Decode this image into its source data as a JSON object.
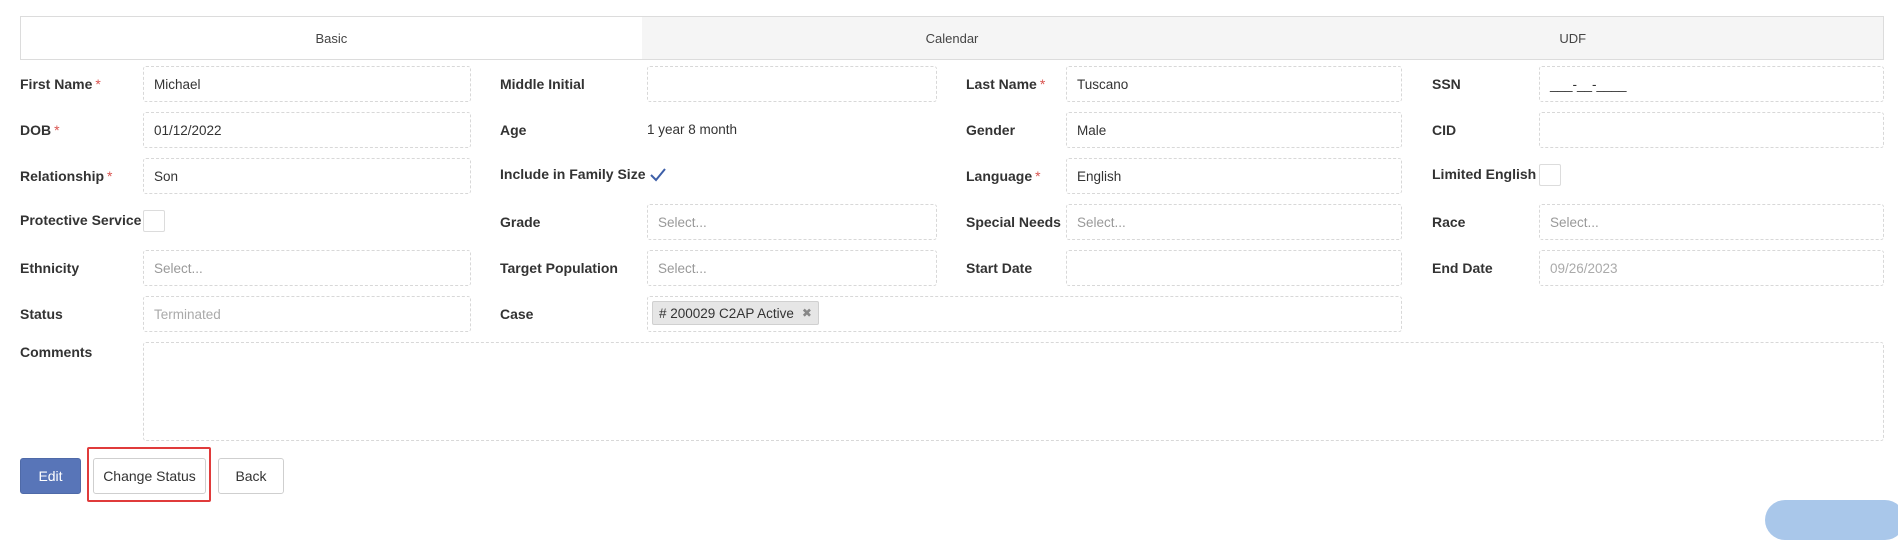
{
  "tabs": [
    "Basic",
    "Calendar",
    "UDF"
  ],
  "labels": {
    "first_name": "First Name",
    "middle_initial": "Middle Initial",
    "last_name": "Last Name",
    "ssn": "SSN",
    "dob": "DOB",
    "age": "Age",
    "gender": "Gender",
    "cid": "CID",
    "relationship": "Relationship",
    "include_family": "Include in Family Size",
    "language": "Language",
    "limited_english": "Limited English",
    "protective_service": "Protective Service",
    "grade": "Grade",
    "special_needs": "Special Needs",
    "race": "Race",
    "ethnicity": "Ethnicity",
    "target_population": "Target Population",
    "start_date": "Start Date",
    "end_date": "End Date",
    "status": "Status",
    "case": "Case",
    "comments": "Comments"
  },
  "required_mark": "*",
  "values": {
    "first_name": "Michael",
    "middle_initial": "",
    "last_name": "Tuscano",
    "ssn": "___-__-____",
    "dob": "01/12/2022",
    "age": "1 year 8 month",
    "gender": "Male",
    "cid": "",
    "relationship": "Son",
    "include_family_checked": true,
    "language": "English",
    "limited_english_checked": false,
    "protective_service_checked": false,
    "grade": "Select...",
    "special_needs": "Select...",
    "race": "Select...",
    "ethnicity": "Select...",
    "target_population": "Select...",
    "start_date": "",
    "end_date": "09/26/2023",
    "status": "Terminated",
    "case_tag": "# 200029 C2AP Active",
    "comments": ""
  },
  "icons": {
    "checkmark": "check-icon",
    "tag_remove": "close-icon"
  },
  "buttons": {
    "edit": "Edit",
    "change_status": "Change Status",
    "back": "Back"
  },
  "colors": {
    "primary": "#5875b8",
    "required": "#d9534f",
    "highlight": "#e03b3b",
    "checkmark": "#3d5fa8"
  }
}
